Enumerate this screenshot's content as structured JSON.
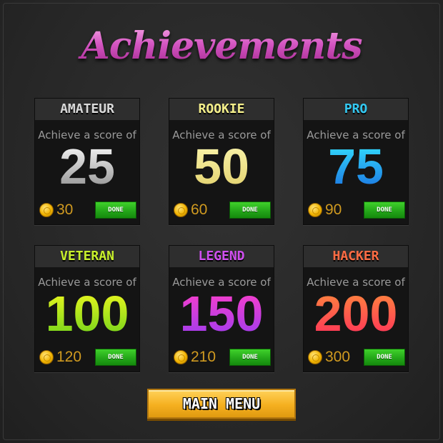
{
  "title": "Achievements",
  "achievements": [
    {
      "name": "AMATEUR",
      "subtitle": "Achieve a score of",
      "score": "25",
      "reward": "30",
      "status": "DONE",
      "name_color": "#d9d9d9",
      "score_gradient": [
        "#ffffff",
        "#8c8c8c"
      ]
    },
    {
      "name": "ROOKIE",
      "subtitle": "Achieve a score of",
      "score": "50",
      "reward": "60",
      "status": "DONE",
      "name_color": "#f3ee8a",
      "score_gradient": [
        "#fbf6b0",
        "#e2d06a"
      ]
    },
    {
      "name": "PRO",
      "subtitle": "Achieve a score of",
      "score": "75",
      "reward": "90",
      "status": "DONE",
      "name_color": "#33c9f2",
      "score_gradient": [
        "#35e4ff",
        "#1a6fe0"
      ]
    },
    {
      "name": "VETERAN",
      "subtitle": "Achieve a score of",
      "score": "100",
      "reward": "120",
      "status": "DONE",
      "name_color": "#c8f02c",
      "score_gradient": [
        "#f4f920",
        "#6cd11a"
      ]
    },
    {
      "name": "LEGEND",
      "subtitle": "Achieve a score of",
      "score": "150",
      "reward": "210",
      "status": "DONE",
      "name_color": "#d04ff0",
      "score_gradient": [
        "#ff3fc8",
        "#9a3cf0"
      ]
    },
    {
      "name": "HACKER",
      "subtitle": "Achieve a score of",
      "score": "200",
      "reward": "300",
      "status": "DONE",
      "name_color": "#ff6c44",
      "score_gradient": [
        "#ff8c3c",
        "#ff2e5a"
      ]
    }
  ],
  "main_menu_label": "MAIN MENU",
  "icons": {
    "coin": "gold-coin-icon"
  }
}
